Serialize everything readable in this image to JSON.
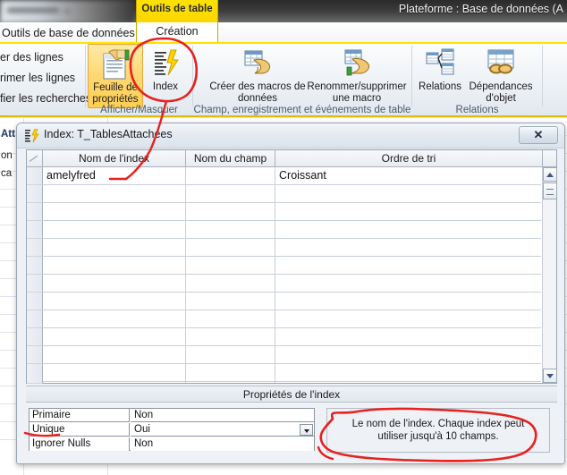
{
  "window": {
    "title": "Plateforme : Base de données (A",
    "contextual_tab_group": "Outils de table"
  },
  "ribbon": {
    "tabs": [
      {
        "label": "Outils de base de données",
        "active": false
      },
      {
        "label": "Création",
        "active": true
      }
    ],
    "groups": [
      {
        "name": "fields-group",
        "title": "",
        "commands": [
          "er des lignes",
          "rimer les lignes",
          "fier les recherches"
        ]
      },
      {
        "name": "show-hide",
        "title": "Afficher/Masquer",
        "buttons": [
          {
            "label": "Feuille de propriétés",
            "icon": "property-sheet-icon",
            "selected": true
          },
          {
            "label": "Index",
            "icon": "index-lightning-icon",
            "selected": false
          }
        ]
      },
      {
        "name": "field-record-table-events",
        "title": "Champ, enregistrement et événements de table",
        "buttons": [
          {
            "label": "Créer des macros de données",
            "icon": "create-data-macro-icon",
            "dropdown": true
          },
          {
            "label": "Renommer/supprimer une macro",
            "icon": "rename-delete-macro-icon",
            "dropdown": false
          }
        ]
      },
      {
        "name": "relationships",
        "title": "Relations",
        "buttons": [
          {
            "label": "Relations",
            "icon": "relationships-icon",
            "dropdown": false
          },
          {
            "label": "Dépendances d'objet",
            "icon": "object-dependencies-icon",
            "dropdown": false
          }
        ]
      }
    ]
  },
  "background_sheet": {
    "fragments": [
      "Att",
      "on",
      "ca"
    ]
  },
  "dialog": {
    "title": "Index: T_TablesAttachees",
    "icon": "index-dialog-icon",
    "close_label": "✕",
    "grid": {
      "columns": [
        "Nom de l'index",
        "Nom du champ",
        "Ordre de tri"
      ],
      "rows": [
        {
          "index_name": "amelyfred",
          "field_name": "",
          "sort_order": "Croissant"
        },
        {
          "index_name": "",
          "field_name": "",
          "sort_order": ""
        },
        {
          "index_name": "",
          "field_name": "",
          "sort_order": ""
        },
        {
          "index_name": "",
          "field_name": "",
          "sort_order": ""
        },
        {
          "index_name": "",
          "field_name": "",
          "sort_order": ""
        },
        {
          "index_name": "",
          "field_name": "",
          "sort_order": ""
        },
        {
          "index_name": "",
          "field_name": "",
          "sort_order": ""
        },
        {
          "index_name": "",
          "field_name": "",
          "sort_order": ""
        },
        {
          "index_name": "",
          "field_name": "",
          "sort_order": ""
        },
        {
          "index_name": "",
          "field_name": "",
          "sort_order": ""
        },
        {
          "index_name": "",
          "field_name": "",
          "sort_order": ""
        },
        {
          "index_name": "",
          "field_name": "",
          "sort_order": ""
        }
      ]
    },
    "properties": {
      "section_title": "Propriétés de l'index",
      "rows": [
        {
          "name": "Primaire",
          "value": "Non",
          "has_dropdown": false
        },
        {
          "name": "Unique",
          "value": "Oui",
          "has_dropdown": true
        },
        {
          "name": "Ignorer Nulls",
          "value": "Non",
          "has_dropdown": false
        }
      ],
      "help_text": "Le nom de l'index. Chaque index peut utiliser jusqu'à 10 champs."
    }
  },
  "annotations": {
    "color": "#e8201f",
    "marks": [
      "circle-around-index-button",
      "arrow-to-index-name-cell",
      "underline-unique-property",
      "circle-around-help-text"
    ]
  }
}
